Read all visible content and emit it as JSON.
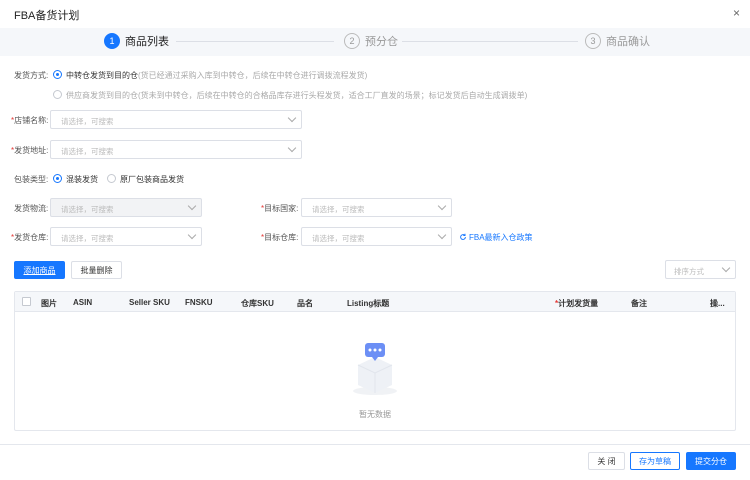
{
  "dialog": {
    "title": "FBA备货计划",
    "close_icon": "×"
  },
  "steps": [
    {
      "num": "1",
      "label": "商品列表",
      "active": true
    },
    {
      "num": "2",
      "label": "预分仓",
      "active": false
    },
    {
      "num": "3",
      "label": "商品确认",
      "active": false
    }
  ],
  "form": {
    "ship_method": {
      "label": "发货方式:",
      "option1_main": "中转仓发货到目的仓",
      "option1_hint": "(货已经通过采购入库到中转仓，后续在中转仓进行调拨流程发货)",
      "option2_main": "供应商发货到目的仓",
      "option2_hint": "(货未到中转仓，后续在中转仓的合格品库存进行头程发货，适合工厂直发的场景；标记发货后自动生成调拨单)"
    },
    "shop_name": {
      "required": "*",
      "label": "店铺名称:",
      "placeholder": "请选择，可搜索"
    },
    "ship_address": {
      "required": "*",
      "label": "发货地址:",
      "placeholder": "请选择，可搜索"
    },
    "pack_type": {
      "label": "包装类型:",
      "option1": "混装发货",
      "option2": "原厂包装商品发货"
    },
    "logistics": {
      "label": "发货物流:",
      "placeholder": "请选择，可搜索"
    },
    "target_country": {
      "required": "*",
      "label": "目标国家:",
      "placeholder": "请选择，可搜索"
    },
    "ship_warehouse": {
      "required": "*",
      "label": "发货仓库:",
      "placeholder": "请选择，可搜索"
    },
    "target_warehouse": {
      "required": "*",
      "label": "目标仓库:",
      "placeholder": "请选择，可搜索"
    },
    "fba_link": "FBA最新入仓政策"
  },
  "toolbar": {
    "add_product": "添加商品",
    "batch_delete": "批量删除",
    "sort_placeholder": "排序方式"
  },
  "table": {
    "columns": [
      "图片",
      "ASIN",
      "Seller SKU",
      "FNSKU",
      "仓库SKU",
      "品名",
      "Listing标题",
      "计划发货量",
      "备注",
      "操..."
    ],
    "planned_required": "*",
    "empty_text": "暂无数据"
  },
  "footer": {
    "close": "关 闭",
    "save_draft": "存为草稿",
    "submit": "提交分仓"
  },
  "colors": {
    "accent": "#1677ff"
  }
}
